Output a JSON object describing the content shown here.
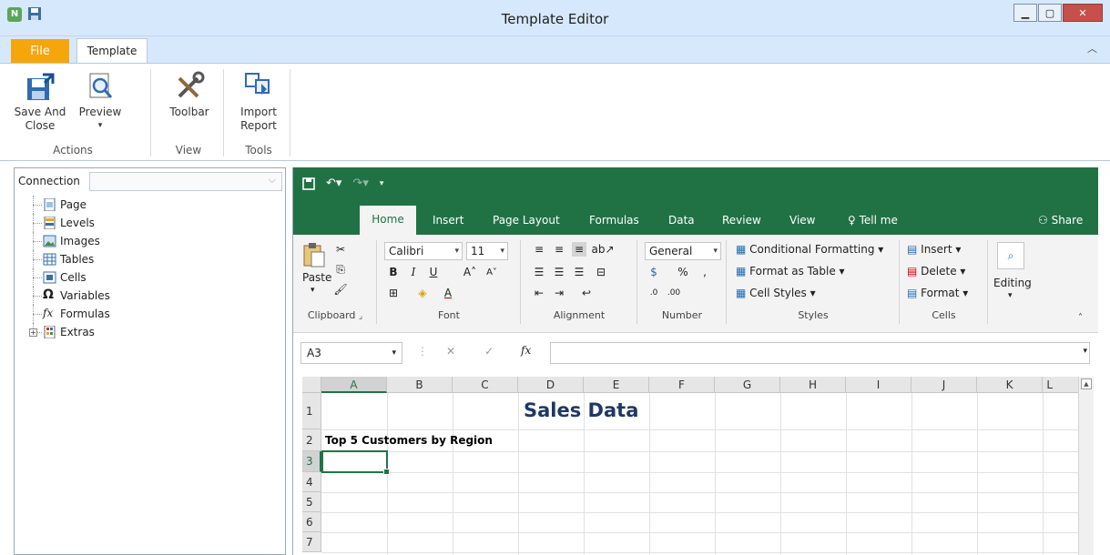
{
  "window": {
    "title": "Template Editor",
    "app_logo": "N"
  },
  "outer_tabs": {
    "file": "File",
    "template": "Template"
  },
  "ribbon": {
    "actions": {
      "save_and_close": "Save And Close",
      "preview": "Preview",
      "label": "Actions"
    },
    "view": {
      "toolbar": "Toolbar",
      "label": "View"
    },
    "tools": {
      "import_report": "Import Report",
      "label": "Tools"
    }
  },
  "left_panel": {
    "connection_label": "Connection",
    "connection_value": "",
    "tree": [
      {
        "label": "Page",
        "icon": "page-icon"
      },
      {
        "label": "Levels",
        "icon": "levels-icon"
      },
      {
        "label": "Images",
        "icon": "images-icon"
      },
      {
        "label": "Tables",
        "icon": "tables-icon"
      },
      {
        "label": "Cells",
        "icon": "cells-icon"
      },
      {
        "label": "Variables",
        "icon": "omega-icon"
      },
      {
        "label": "Formulas",
        "icon": "fx-icon"
      },
      {
        "label": "Extras",
        "icon": "extras-icon"
      }
    ]
  },
  "excel": {
    "tabs": [
      "Home",
      "Insert",
      "Page Layout",
      "Formulas",
      "Data",
      "Review",
      "View",
      "Tell me"
    ],
    "share": "Share",
    "clipboard": {
      "paste": "Paste",
      "label": "Clipboard"
    },
    "font": {
      "name": "Calibri",
      "size": "11",
      "label": "Font"
    },
    "alignment": {
      "label": "Alignment"
    },
    "number": {
      "format": "General",
      "label": "Number"
    },
    "styles": {
      "conditional": "Conditional Formatting",
      "format_table": "Format as Table",
      "cell_styles": "Cell Styles",
      "label": "Styles"
    },
    "cells": {
      "insert": "Insert",
      "delete": "Delete",
      "format": "Format",
      "label": "Cells"
    },
    "editing": {
      "label": "Editing"
    },
    "name_box": "A3",
    "columns": [
      "A",
      "B",
      "C",
      "D",
      "E",
      "F",
      "G",
      "H",
      "I",
      "J",
      "K",
      "L"
    ],
    "rows": [
      "1",
      "2",
      "3",
      "4",
      "5",
      "6",
      "7"
    ],
    "sheet": {
      "title": "Sales Data",
      "subtitle": "Top 5 Customers by Region"
    }
  },
  "colors": {
    "excel_green": "#207245",
    "title_blue": "#1f3864",
    "file_tab": "#f5a60a"
  }
}
